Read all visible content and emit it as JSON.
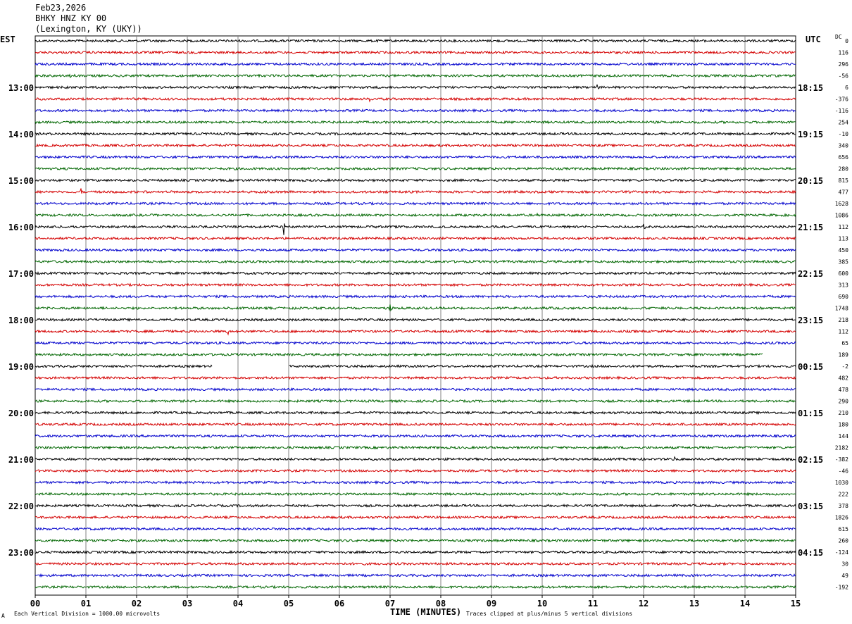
{
  "header": {
    "date": "Feb23,2026",
    "station": "BHKY HNZ KY 00",
    "location": "(Lexington, KY (UKY))"
  },
  "left_zone": "EST",
  "right_zone": "UTC",
  "dc_label": "DC",
  "footer": {
    "left_mark": "A",
    "scale_note": "Each Vertical Division = 1000.00 microvolts",
    "x_title": "TIME (MINUTES)",
    "clip_note": "Traces clipped at plus/minus 5 vertical divisions"
  },
  "colors": {
    "cycle": [
      "#000000",
      "#d40000",
      "#0000cc",
      "#006600"
    ],
    "grid": "#808080"
  },
  "chart_data": {
    "type": "line",
    "description_type": "helicorder",
    "x_range": [
      0,
      15
    ],
    "x_ticks": [
      "00",
      "01",
      "02",
      "03",
      "04",
      "05",
      "06",
      "07",
      "08",
      "09",
      "10",
      "11",
      "12",
      "13",
      "14",
      "15"
    ],
    "left_hour_labels": [
      {
        "row": 4,
        "text": "13:00"
      },
      {
        "row": 8,
        "text": "14:00"
      },
      {
        "row": 12,
        "text": "15:00"
      },
      {
        "row": 16,
        "text": "16:00"
      },
      {
        "row": 20,
        "text": "17:00"
      },
      {
        "row": 24,
        "text": "18:00"
      },
      {
        "row": 28,
        "text": "19:00"
      },
      {
        "row": 32,
        "text": "20:00"
      },
      {
        "row": 36,
        "text": "21:00"
      },
      {
        "row": 40,
        "text": "22:00"
      },
      {
        "row": 44,
        "text": "23:00"
      }
    ],
    "right_hour_labels": [
      {
        "row": 4,
        "text": "18:15"
      },
      {
        "row": 8,
        "text": "19:15"
      },
      {
        "row": 12,
        "text": "20:15"
      },
      {
        "row": 16,
        "text": "21:15"
      },
      {
        "row": 20,
        "text": "22:15"
      },
      {
        "row": 24,
        "text": "23:15"
      },
      {
        "row": 28,
        "text": "00:15"
      },
      {
        "row": 32,
        "text": "01:15"
      },
      {
        "row": 36,
        "text": "02:15"
      },
      {
        "row": 40,
        "text": "03:15"
      },
      {
        "row": 44,
        "text": "04:15"
      }
    ],
    "dc_offsets": [
      "0",
      "116",
      "296",
      "-56",
      "6",
      "-376",
      "-116",
      "254",
      "-10",
      "340",
      "656",
      "280",
      "815",
      "477",
      "1628",
      "1086",
      "112",
      "113",
      "450",
      "385",
      "600",
      "313",
      "690",
      "1748",
      "218",
      "112",
      "65",
      "189",
      "-2",
      "482",
      "478",
      "290",
      "210",
      "180",
      "144",
      "2182",
      "-382",
      "-46",
      "1030",
      "222",
      "378",
      "1826",
      "615",
      "260",
      "-124",
      "30",
      "49",
      "-192"
    ],
    "events": [
      {
        "row": 3,
        "minute": 0.7,
        "amp": 2.0
      },
      {
        "row": 4,
        "minute": 11.1,
        "amp": 1.3
      },
      {
        "row": 5,
        "minute": 6.6,
        "amp": 0.9
      },
      {
        "row": 13,
        "minute": 0.9,
        "amp": 1.6
      },
      {
        "row": 15,
        "minute": 9.9,
        "amp": 1.0
      },
      {
        "row": 16,
        "minute": 4.9,
        "amp": 3.5
      },
      {
        "row": 16,
        "minute": 12.0,
        "amp": 1.0
      },
      {
        "row": 23,
        "minute": 7.0,
        "amp": 1.2
      },
      {
        "row": 25,
        "minute": 3.8,
        "amp": 1.6
      },
      {
        "row": 36,
        "minute": 12.6,
        "amp": 0.9
      }
    ],
    "gaps": [
      {
        "row": 27,
        "from_minute": 14.35,
        "to_minute": 15
      },
      {
        "row": 28,
        "from_minute": 3.5,
        "to_minute": 5.0
      }
    ],
    "row_count": 48
  }
}
